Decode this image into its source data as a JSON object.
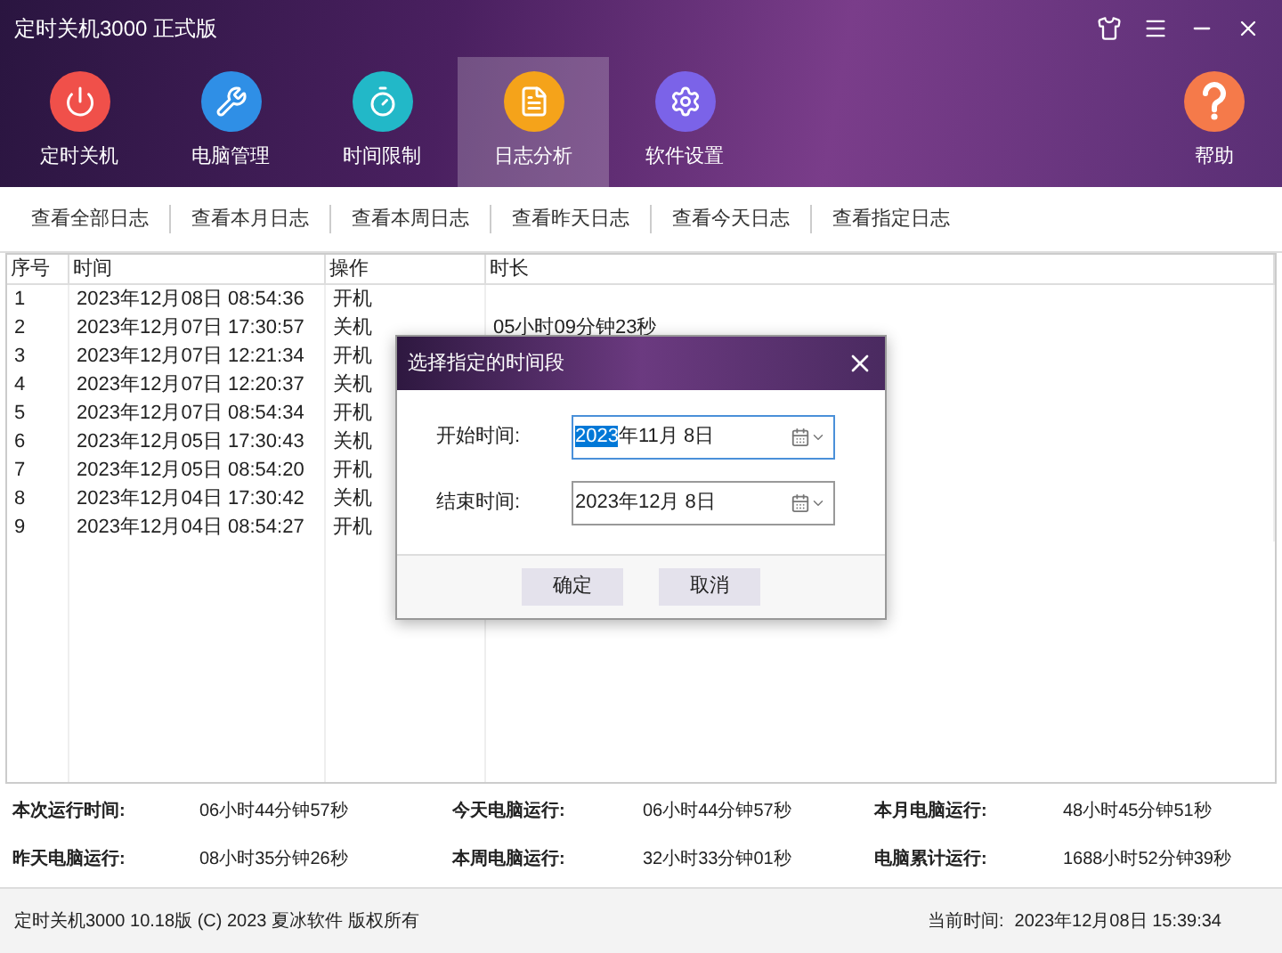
{
  "window": {
    "title": "定时关机3000 正式版"
  },
  "nav": [
    {
      "label": "定时关机",
      "kind": "power",
      "color": "#f0504a",
      "selected": false
    },
    {
      "label": "电脑管理",
      "kind": "tools",
      "color": "#2f8fe6",
      "selected": false
    },
    {
      "label": "时间限制",
      "kind": "timer",
      "color": "#22b8c8",
      "selected": false
    },
    {
      "label": "日志分析",
      "kind": "log",
      "color": "#f5a31a",
      "selected": true
    },
    {
      "label": "软件设置",
      "kind": "settings",
      "color": "#7b63e8",
      "selected": false
    }
  ],
  "help": {
    "label": "帮助",
    "color": "#f57a4a"
  },
  "toolbar": [
    "查看全部日志",
    "查看本月日志",
    "查看本周日志",
    "查看昨天日志",
    "查看今天日志",
    "查看指定日志"
  ],
  "table": {
    "columns": [
      "序号",
      "时间",
      "操作",
      "时长"
    ],
    "rows": [
      [
        "1",
        "2023年12月08日 08:54:36",
        "开机",
        ""
      ],
      [
        "2",
        "2023年12月07日 17:30:57",
        "关机",
        "05小时09分钟23秒"
      ],
      [
        "3",
        "2023年12月07日 12:21:34",
        "开机",
        ""
      ],
      [
        "4",
        "2023年12月07日 12:20:37",
        "关机",
        ""
      ],
      [
        "5",
        "2023年12月07日 08:54:34",
        "开机",
        ""
      ],
      [
        "6",
        "2023年12月05日 17:30:43",
        "关机",
        ""
      ],
      [
        "7",
        "2023年12月05日 08:54:20",
        "开机",
        ""
      ],
      [
        "8",
        "2023年12月04日 17:30:42",
        "关机",
        ""
      ],
      [
        "9",
        "2023年12月04日 08:54:27",
        "开机",
        ""
      ]
    ]
  },
  "stats": [
    {
      "label": "本次运行时间:",
      "value": "06小时44分钟57秒"
    },
    {
      "label": "今天电脑运行:",
      "value": "06小时44分钟57秒"
    },
    {
      "label": "本月电脑运行:",
      "value": "48小时45分钟51秒"
    },
    {
      "label": "昨天电脑运行:",
      "value": "08小时35分钟26秒"
    },
    {
      "label": "本周电脑运行:",
      "value": "32小时33分钟01秒"
    },
    {
      "label": "电脑累计运行:",
      "value": "1688小时52分钟39秒"
    }
  ],
  "status_bar": {
    "copyright": "定时关机3000 10.18版 (C) 2023  夏冰软件 版权所有",
    "clock_label": "当前时间:",
    "clock": "2023年12月08日 15:39:34"
  },
  "dialog": {
    "title": "选择指定的时间段",
    "fields": [
      {
        "label": "开始时间:",
        "selection": "2023",
        "rest": "年11月  8日",
        "focused": true
      },
      {
        "label": "结束时间:",
        "rest": "2023年12月  8日",
        "focused": false
      }
    ],
    "buttons": [
      "确定",
      "取消"
    ]
  }
}
